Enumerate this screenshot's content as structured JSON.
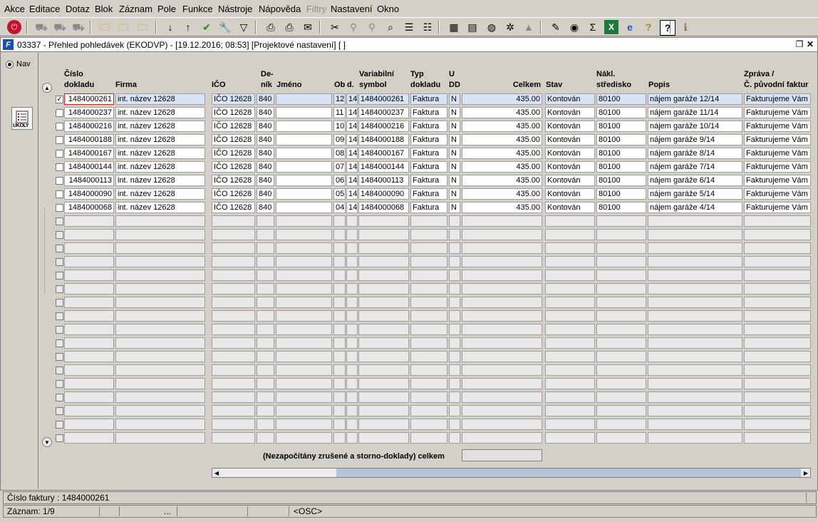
{
  "menu": [
    "Akce",
    "Editace",
    "Dotaz",
    "Blok",
    "Záznam",
    "Pole",
    "Funkce",
    "Nástroje",
    "Nápověda",
    "Filtry",
    "Nastavení",
    "Okno"
  ],
  "toolbar_icons": [
    "exit-icon",
    "truck-icon",
    "truck-icon",
    "truck-icon",
    "folder-search-icon",
    "folder-search-icon",
    "folder-delete-icon",
    "sort-asc-icon",
    "sort-desc-icon",
    "check-icon",
    "wrench-icon",
    "filter-icon",
    "print-icon",
    "print-preview-icon",
    "mail-icon",
    "cut-icon",
    "pin-icon",
    "pin-icon",
    "search-icon",
    "list-icon",
    "tree-icon",
    "calculator-icon",
    "notepad-icon",
    "globe-icon",
    "gear-icon",
    "chart-icon",
    "edit-icon",
    "disk-icon",
    "sum-icon",
    "excel-icon",
    "ie-icon",
    "help-search-icon",
    "help-icon",
    "info-icon"
  ],
  "window": {
    "title_icon": "F",
    "title": "03337 - Přehled pohledávek (EKODVP) - [19.12.2016; 08:53]  [Projektové nastavení]  [ ]"
  },
  "nav": {
    "radio_label": "Nav",
    "ukoly_label": "ÚKOLY"
  },
  "columns": {
    "cislo": "Číslo\ndokladu",
    "firma": "Firma",
    "ico": "IČO",
    "denik": "De-\nník",
    "jmeno": "Jméno",
    "ob": "Ob",
    "d": "d.",
    "varsym": "Variabilní\nsymbol",
    "typ": "Typ\ndokladu",
    "udd": "U\nDD",
    "celkem": "Celkem",
    "stav": "Stav",
    "nakl": "Nákl.\nstředisko",
    "popis": "Popis",
    "zprava": "Zpráva /\nČ. původní faktur"
  },
  "rows": [
    {
      "cislo": "1484000261",
      "firma": "int. název 12628",
      "ico": "IČO 12628",
      "denik": "840",
      "jmeno": "",
      "ob": "12",
      "d": "14",
      "varsym": "1484000261",
      "typ": "Faktura",
      "udd": "N",
      "celkem": "435.00",
      "stav": "Kontován",
      "nakl": "80100",
      "popis": "nájem garáže 12/14",
      "zprava": "Fakturujeme Vám n"
    },
    {
      "cislo": "1484000237",
      "firma": "int. název 12628",
      "ico": "IČO 12628",
      "denik": "840",
      "jmeno": "",
      "ob": "11",
      "d": "14",
      "varsym": "1484000237",
      "typ": "Faktura",
      "udd": "N",
      "celkem": "435.00",
      "stav": "Kontován",
      "nakl": "80100",
      "popis": "nájem garáže 11/14",
      "zprava": "Fakturujeme Vám n"
    },
    {
      "cislo": "1484000216",
      "firma": "int. název 12628",
      "ico": "IČO 12628",
      "denik": "840",
      "jmeno": "",
      "ob": "10",
      "d": "14",
      "varsym": "1484000216",
      "typ": "Faktura",
      "udd": "N",
      "celkem": "435.00",
      "stav": "Kontován",
      "nakl": "80100",
      "popis": "nájem garáže 10/14",
      "zprava": "Fakturujeme Vám n"
    },
    {
      "cislo": "1484000188",
      "firma": "int. název 12628",
      "ico": "IČO 12628",
      "denik": "840",
      "jmeno": "",
      "ob": "09",
      "d": "14",
      "varsym": "1484000188",
      "typ": "Faktura",
      "udd": "N",
      "celkem": "435.00",
      "stav": "Kontován",
      "nakl": "80100",
      "popis": "nájem garáže 9/14",
      "zprava": "Fakturujeme Vám n"
    },
    {
      "cislo": "1484000167",
      "firma": "int. název 12628",
      "ico": "IČO 12628",
      "denik": "840",
      "jmeno": "",
      "ob": "08",
      "d": "14",
      "varsym": "1484000167",
      "typ": "Faktura",
      "udd": "N",
      "celkem": "435.00",
      "stav": "Kontován",
      "nakl": "80100",
      "popis": "nájem garáže 8/14",
      "zprava": "Fakturujeme Vám n"
    },
    {
      "cislo": "1484000144",
      "firma": "int. název 12628",
      "ico": "IČO 12628",
      "denik": "840",
      "jmeno": "",
      "ob": "07",
      "d": "14",
      "varsym": "1484000144",
      "typ": "Faktura",
      "udd": "N",
      "celkem": "435.00",
      "stav": "Kontován",
      "nakl": "80100",
      "popis": "nájem garáže 7/14",
      "zprava": "Fakturujeme Vám n"
    },
    {
      "cislo": "1484000113",
      "firma": "int. název 12628",
      "ico": "IČO 12628",
      "denik": "840",
      "jmeno": "",
      "ob": "06",
      "d": "14",
      "varsym": "1484000113",
      "typ": "Faktura",
      "udd": "N",
      "celkem": "435.00",
      "stav": "Kontován",
      "nakl": "80100",
      "popis": "nájem garáže 6/14",
      "zprava": "Fakturujeme Vám n"
    },
    {
      "cislo": "1484000090",
      "firma": "int. název 12628",
      "ico": "IČO 12628",
      "denik": "840",
      "jmeno": "",
      "ob": "05",
      "d": "14",
      "varsym": "1484000090",
      "typ": "Faktura",
      "udd": "N",
      "celkem": "435.00",
      "stav": "Kontován",
      "nakl": "80100",
      "popis": "nájem garáže 5/14",
      "zprava": "Fakturujeme Vám n"
    },
    {
      "cislo": "1484000068",
      "firma": "int. název 12628",
      "ico": "IČO 12628",
      "denik": "840",
      "jmeno": "",
      "ob": "04",
      "d": "14",
      "varsym": "1484000068",
      "typ": "Faktura",
      "udd": "N",
      "celkem": "435.00",
      "stav": "Kontován",
      "nakl": "80100",
      "popis": "nájem garáže 4/14",
      "zprava": "Fakturujeme Vám n"
    }
  ],
  "selected_row": 0,
  "selected_checked": true,
  "footer": {
    "label": "(Nezapočítány zrušené a storno-doklady) celkem",
    "value": ""
  },
  "status": {
    "field_info": "Číslo faktury : 1484000261",
    "record": "Záznam: 1/9",
    "ellipsis": "...",
    "mode": "<OSC>"
  },
  "colors": {
    "selected_row": "#d6e4f5",
    "focus_border": "#d02020",
    "title_icon": "#1b4fa8"
  }
}
